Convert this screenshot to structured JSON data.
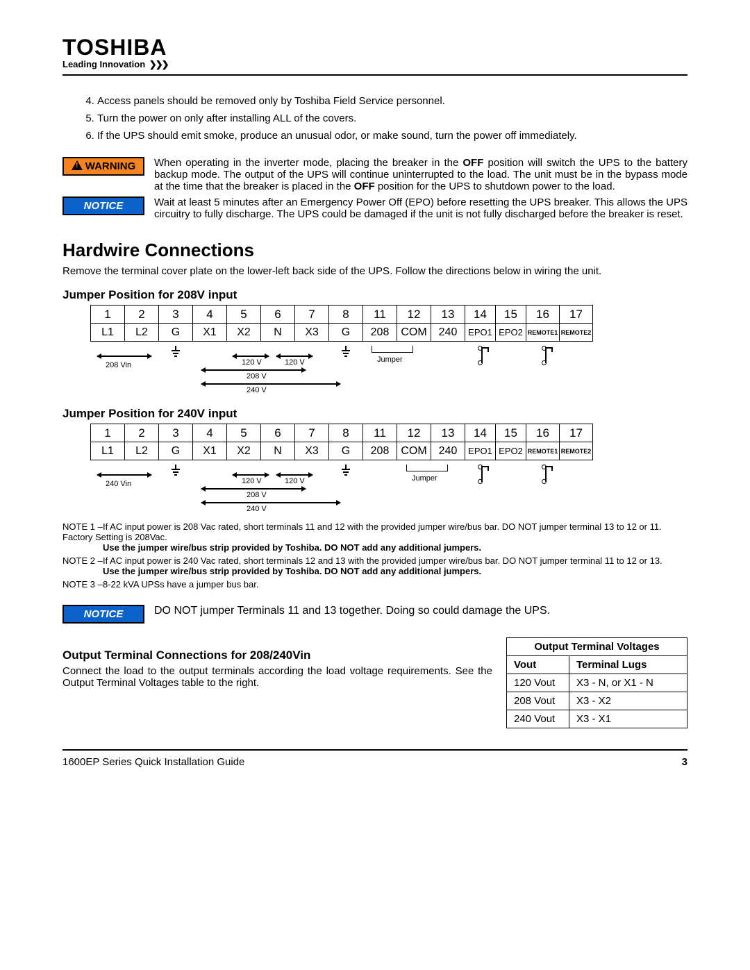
{
  "brand": {
    "name": "TOSHIBA",
    "tagline": "Leading Innovation",
    "chev": "❯❯❯"
  },
  "list": {
    "start": 4,
    "items": [
      "Access panels should be removed only by Toshiba Field Service personnel.",
      "Turn the power on only after installing ALL of the covers.",
      "If the UPS should emit smoke, produce an unusual odor, or make sound, turn the power off immediately."
    ]
  },
  "warning": {
    "label": "WARNING",
    "text_a": "When operating in the inverter mode, placing the breaker in the ",
    "off1": "OFF",
    "text_b": " position will switch the UPS to the battery backup mode. The output of the UPS will continue uninterrupted to the load. The unit must be in the bypass mode at the time that the breaker is placed in the ",
    "off2": "OFF",
    "text_c": " position for the UPS to shutdown power to the load."
  },
  "notice1": {
    "label": "NOTICE",
    "text": "Wait at least 5 minutes after an Emergency Power Off (EPO) before resetting the UPS breaker.  This allows the UPS circuitry to fully discharge. The UPS could be damaged if the unit is not fully discharged before the breaker is reset."
  },
  "h1": "Hardwire Connections",
  "intro": "Remove the terminal cover plate on the lower-left back side of the UPS.  Follow the directions below in wiring the unit.",
  "sub208": "Jumper Position for 208V input",
  "sub240": "Jumper Position for 240V input",
  "term": {
    "nums": [
      "1",
      "2",
      "3",
      "4",
      "5",
      "6",
      "7",
      "8",
      "11",
      "12",
      "13",
      "14",
      "15",
      "16",
      "17"
    ],
    "labels": [
      "L1",
      "L2",
      "G",
      "X1",
      "X2",
      "N",
      "X3",
      "G",
      "208",
      "COM",
      "240",
      "EPO1",
      "EPO2",
      "REMOTE1",
      "REMOTE2"
    ]
  },
  "diag": {
    "vin208": "208 Vin",
    "vin240": "240 Vin",
    "v120": "120 V",
    "v208": "208 V",
    "v240": "240 V",
    "jumper": "Jumper"
  },
  "notes": {
    "n1a": "If AC input power is 208 Vac rated, short terminals 11 and 12 with the provided jumper wire/bus bar.  DO NOT jumper terminal 13 to 12 or 11.  Factory Setting is 208Vac. ",
    "n1b": "Use the jumper wire/bus strip provided by Toshiba. DO NOT add any additional jumpers.",
    "n2a": "If AC input power is 240 Vac rated, short terminals 12 and 13 with the provided jumper wire/bus bar.  DO NOT jumper  terminal 11 to 12 or 13.  ",
    "n2b": "Use the jumper wire/bus strip provided by Toshiba. DO NOT add any additional jumpers.",
    "n3": "8-22 kVA UPSs have a jumper bus bar.",
    "l1": "NOTE 1 –",
    "l2": "NOTE 2 –",
    "l3": "NOTE 3 –"
  },
  "notice2": {
    "label": "NOTICE",
    "text": "DO NOT  jumper Terminals 11 and 13 together.  Doing so could damage the UPS."
  },
  "output": {
    "title": "Output Terminal Connections for 208/240Vin",
    "p1": "Connect the load to the output terminals according the load voltage requirements.  See the Output Terminal Voltages table to the right.",
    "thdr": "Output Terminal Voltages",
    "c1": "Vout",
    "c2": "Terminal Lugs",
    "rows": [
      {
        "v": "120 Vout",
        "t": "X3 - N, or X1 - N"
      },
      {
        "v": "208 Vout",
        "t": "X3 - X2"
      },
      {
        "v": "240 Vout",
        "t": "X3 - X1"
      }
    ]
  },
  "footer": {
    "doc": "1600EP Series Quick Installation Guide",
    "page": "3"
  }
}
